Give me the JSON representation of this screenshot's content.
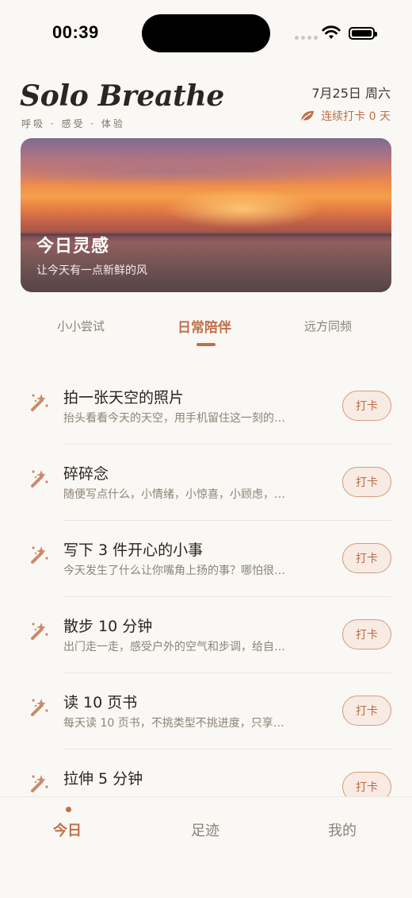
{
  "status_bar": {
    "time": "00:39"
  },
  "header": {
    "app_title": "Solo Breathe",
    "tagline": "呼吸 · 感受 · 体验",
    "date": "7月25日 周六",
    "streak": "连续打卡 0 天"
  },
  "hero": {
    "title": "今日灵感",
    "subtitle": "让今天有一点新鲜的风"
  },
  "tabs": [
    {
      "label": "小小尝试",
      "active": false
    },
    {
      "label": "日常陪伴",
      "active": true
    },
    {
      "label": "远方同频",
      "active": false
    }
  ],
  "items": [
    {
      "icon": "magic-wand-icon",
      "title": "拍一张天空的照片",
      "desc": "抬头看看今天的天空，用手机留住这一刻的…",
      "button": "打卡"
    },
    {
      "icon": "magic-wand-icon",
      "title": "碎碎念",
      "desc": "随便写点什么，小情绪，小惊喜，小顾虑，…",
      "button": "打卡"
    },
    {
      "icon": "magic-wand-icon",
      "title": "写下 3 件开心的小事",
      "desc": "今天发生了什么让你嘴角上扬的事？哪怕很…",
      "button": "打卡"
    },
    {
      "icon": "magic-wand-icon",
      "title": "散步 10 分钟",
      "desc": "出门走一走，感受户外的空气和步调，给自…",
      "button": "打卡"
    },
    {
      "icon": "magic-wand-icon",
      "title": "读 10 页书",
      "desc": "每天读 10 页书，不挑类型不挑进度，只享…",
      "button": "打卡"
    },
    {
      "icon": "magic-wand-icon",
      "title": "拉伸 5 分钟",
      "desc": "",
      "button": "打卡"
    }
  ],
  "bottom_nav": [
    {
      "label": "今日",
      "active": true
    },
    {
      "label": "足迹",
      "active": false
    },
    {
      "label": "我的",
      "active": false
    }
  ],
  "colors": {
    "accent": "#c06f4a",
    "background": "#faf8f4",
    "button_fill": "#f7ebe4"
  }
}
